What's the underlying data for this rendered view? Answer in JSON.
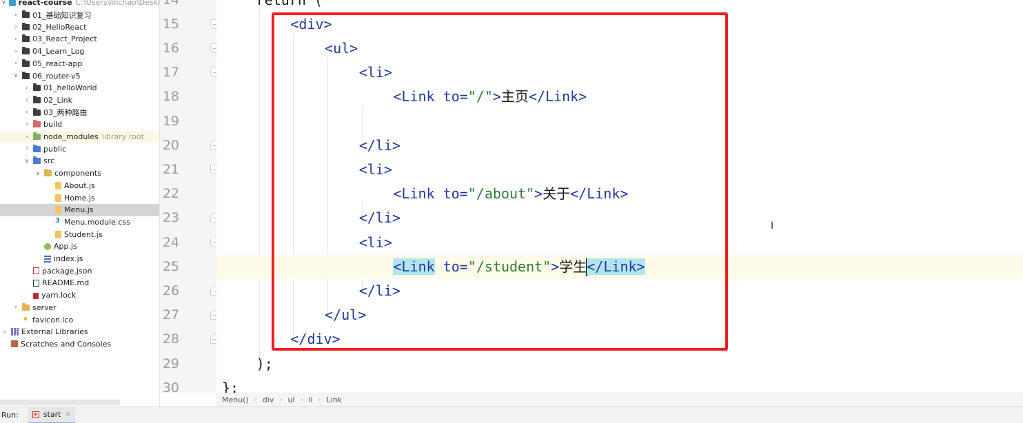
{
  "project_tree": {
    "items": [
      {
        "depth": 0,
        "expanded": true,
        "icon": "module",
        "label": "react-course",
        "hint": "C:\\Users\\lilichao\\Desktop",
        "bold": true
      },
      {
        "depth": 1,
        "expanded": false,
        "icon": "folder",
        "label": "01_基础知识复习"
      },
      {
        "depth": 1,
        "expanded": false,
        "icon": "folder",
        "label": "02_HelloReact"
      },
      {
        "depth": 1,
        "expanded": false,
        "icon": "folder",
        "label": "03_React_Project"
      },
      {
        "depth": 1,
        "expanded": false,
        "icon": "folder",
        "label": "04_Learn_Log"
      },
      {
        "depth": 1,
        "expanded": false,
        "icon": "folder",
        "label": "05_react-app"
      },
      {
        "depth": 1,
        "expanded": true,
        "icon": "folder",
        "label": "06_router-v5"
      },
      {
        "depth": 2,
        "expanded": false,
        "icon": "folder",
        "label": "01_helloWorld"
      },
      {
        "depth": 2,
        "expanded": false,
        "icon": "folder",
        "label": "02_Link"
      },
      {
        "depth": 2,
        "expanded": false,
        "icon": "folder",
        "label": "03_两种路由"
      },
      {
        "depth": 2,
        "expanded": false,
        "icon": "folder-red",
        "label": "build"
      },
      {
        "depth": 2,
        "expanded": false,
        "icon": "folder-green",
        "label": "node_modules",
        "hint": "library root",
        "lib_root": true
      },
      {
        "depth": 2,
        "expanded": false,
        "icon": "folder-blue",
        "label": "public"
      },
      {
        "depth": 2,
        "expanded": true,
        "icon": "folder-blue",
        "label": "src"
      },
      {
        "depth": 3,
        "expanded": true,
        "icon": "folder-yellow",
        "label": "components"
      },
      {
        "depth": 4,
        "icon": "file-js",
        "label": "About.js"
      },
      {
        "depth": 4,
        "icon": "file-js",
        "label": "Home.js"
      },
      {
        "depth": 4,
        "icon": "file-js",
        "label": "Menu.js",
        "selected": true
      },
      {
        "depth": 4,
        "icon": "file-css",
        "label": "Menu.module.css"
      },
      {
        "depth": 4,
        "icon": "file-js",
        "label": "Student.js"
      },
      {
        "depth": 3,
        "icon": "file-node",
        "label": "App.js"
      },
      {
        "depth": 3,
        "icon": "file-idx",
        "label": "index.js"
      },
      {
        "depth": 2,
        "icon": "file-pkg",
        "label": "package.json"
      },
      {
        "depth": 2,
        "icon": "file-md",
        "label": "README.md"
      },
      {
        "depth": 2,
        "icon": "file-lock",
        "label": "yarn.lock"
      },
      {
        "depth": 1,
        "expanded": false,
        "icon": "folder-yellow",
        "label": "server"
      },
      {
        "depth": 1,
        "icon": "file-star",
        "label": "favicon.ico"
      },
      {
        "depth": 0,
        "expanded": false,
        "icon": "lib",
        "label": "External Libraries"
      },
      {
        "depth": 0,
        "icon": "scratch",
        "label": "Scratches and Consoles"
      }
    ]
  },
  "editor": {
    "current_line": "25",
    "lines": [
      {
        "num": "14",
        "indent": 6,
        "tokens": [
          {
            "t": "plain",
            "v": "return ("
          }
        ]
      },
      {
        "num": "15",
        "indent": 12,
        "tokens": [
          {
            "t": "tag",
            "v": "<div>"
          }
        ]
      },
      {
        "num": "16",
        "indent": 18,
        "tokens": [
          {
            "t": "tag",
            "v": "<ul>"
          }
        ]
      },
      {
        "num": "17",
        "indent": 24,
        "tokens": [
          {
            "t": "tag",
            "v": "<li>"
          }
        ]
      },
      {
        "num": "18",
        "indent": 30,
        "tokens": [
          {
            "t": "tag",
            "v": "<Link "
          },
          {
            "t": "attr",
            "v": "to="
          },
          {
            "t": "str",
            "v": "\"/\""
          },
          {
            "t": "tag",
            "v": ">"
          },
          {
            "t": "txt",
            "v": "主页"
          },
          {
            "t": "tag",
            "v": "</Link>"
          }
        ]
      },
      {
        "num": "19",
        "indent": 0,
        "tokens": []
      },
      {
        "num": "20",
        "indent": 24,
        "tokens": [
          {
            "t": "tag",
            "v": "</li>"
          }
        ]
      },
      {
        "num": "21",
        "indent": 24,
        "tokens": [
          {
            "t": "tag",
            "v": "<li>"
          }
        ]
      },
      {
        "num": "22",
        "indent": 30,
        "tokens": [
          {
            "t": "tag",
            "v": "<Link "
          },
          {
            "t": "attr",
            "v": "to="
          },
          {
            "t": "str",
            "v": "\"/about\""
          },
          {
            "t": "tag",
            "v": ">"
          },
          {
            "t": "txt",
            "v": "关于"
          },
          {
            "t": "tag",
            "v": "</Link>"
          }
        ]
      },
      {
        "num": "23",
        "indent": 24,
        "tokens": [
          {
            "t": "tag",
            "v": "</li>"
          }
        ]
      },
      {
        "num": "24",
        "indent": 24,
        "tokens": [
          {
            "t": "tag",
            "v": "<li>"
          }
        ]
      },
      {
        "num": "25",
        "indent": 30,
        "tokens": [
          {
            "t": "tag",
            "v": "<Link",
            "hl": true
          },
          {
            "t": "tag",
            "v": " "
          },
          {
            "t": "attr",
            "v": "to="
          },
          {
            "t": "str",
            "v": "\"/student\""
          },
          {
            "t": "tag",
            "v": ">"
          },
          {
            "t": "txt",
            "v": "学生"
          },
          {
            "t": "caret",
            "v": ""
          },
          {
            "t": "tag",
            "v": "</Link>",
            "hl": true
          }
        ]
      },
      {
        "num": "26",
        "indent": 24,
        "tokens": [
          {
            "t": "tag",
            "v": "</li>"
          }
        ]
      },
      {
        "num": "27",
        "indent": 18,
        "tokens": [
          {
            "t": "tag",
            "v": "</ul>"
          }
        ]
      },
      {
        "num": "28",
        "indent": 12,
        "tokens": [
          {
            "t": "tag",
            "v": "</div>"
          }
        ]
      },
      {
        "num": "29",
        "indent": 6,
        "tokens": [
          {
            "t": "plain",
            "v": ");"
          }
        ]
      },
      {
        "num": "30",
        "indent": 0,
        "tokens": [
          {
            "t": "plain",
            "v": "};"
          }
        ]
      }
    ]
  },
  "breadcrumb": [
    "Menu()",
    "div",
    "ul",
    "li",
    "Link"
  ],
  "run_bar": {
    "label": "Run:",
    "tab_label": "start",
    "close_glyph": "×"
  },
  "colors": {
    "highlight_box": "#ef1f1f",
    "tag": "#1f3a9c",
    "string": "#2f7d32",
    "current_line": "#fefbe9",
    "match_highlight": "#b3e5ef"
  }
}
